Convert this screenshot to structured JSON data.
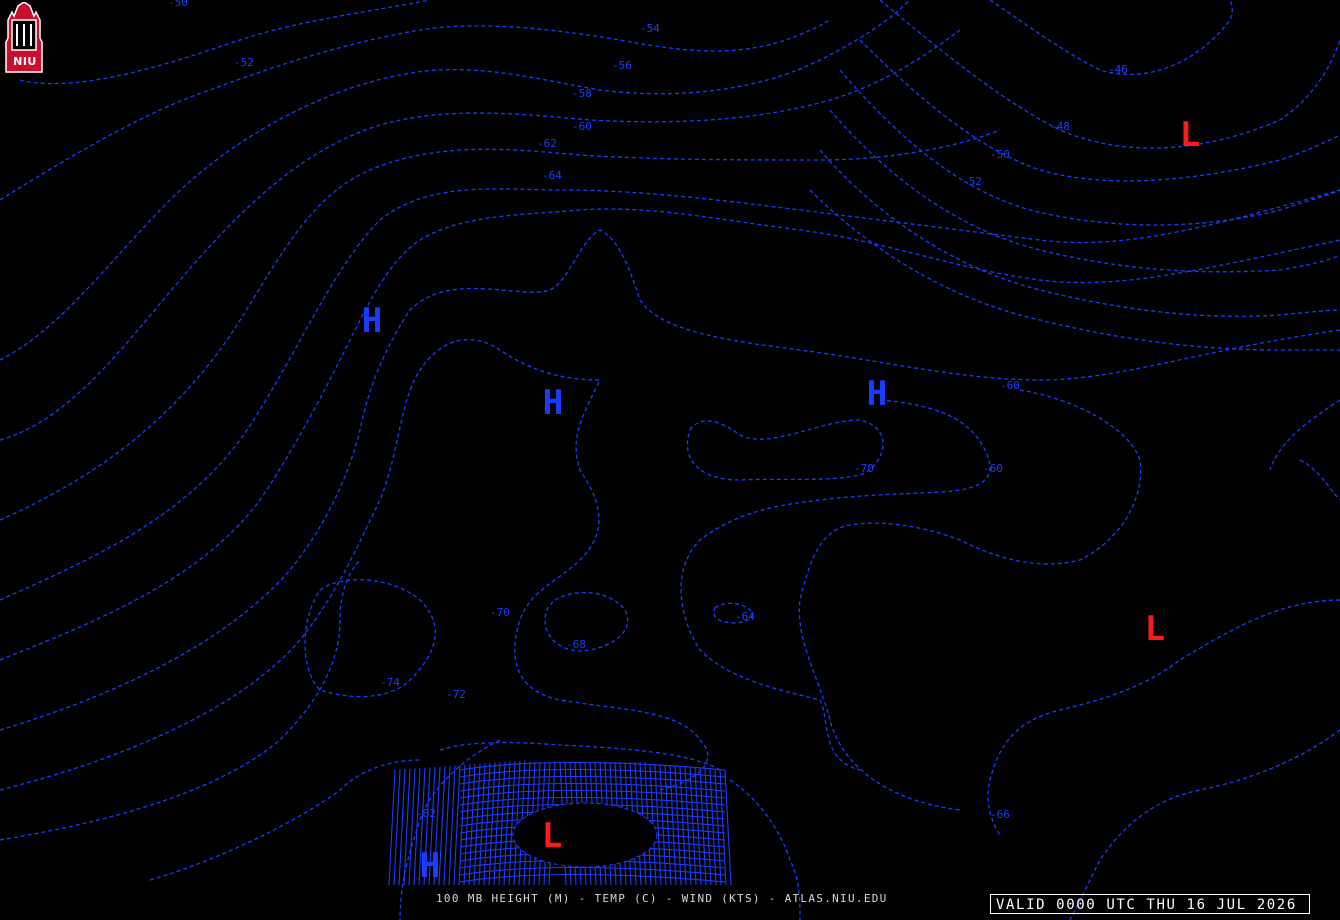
{
  "logo": {
    "text": "NIU"
  },
  "title": "100 MB HEIGHT (M) - TEMP (C) - WIND (KTS) - ATLAS.NIU.EDU",
  "valid_time": "VALID 0000 UTC THU 16 JUL 2026",
  "colors": {
    "background": "#000000",
    "contour": "#1a3cff",
    "high": "#1a3cff",
    "low": "#ff1a1a",
    "text": "#ffffff"
  },
  "pressure_centers": [
    {
      "type": "H"
    },
    {
      "type": "H"
    },
    {
      "type": "H"
    },
    {
      "type": "H"
    },
    {
      "type": "L"
    },
    {
      "type": "L"
    },
    {
      "type": "L"
    }
  ],
  "contour_labels": [
    "-50",
    "-52",
    "-54",
    "-56",
    "-58",
    "-60",
    "-62",
    "-64",
    "-46",
    "-48",
    "-50",
    "-52",
    "-60",
    "-60",
    "-70",
    "-70",
    "-68",
    "-64",
    "-74",
    "-72",
    "-82",
    "-66"
  ]
}
